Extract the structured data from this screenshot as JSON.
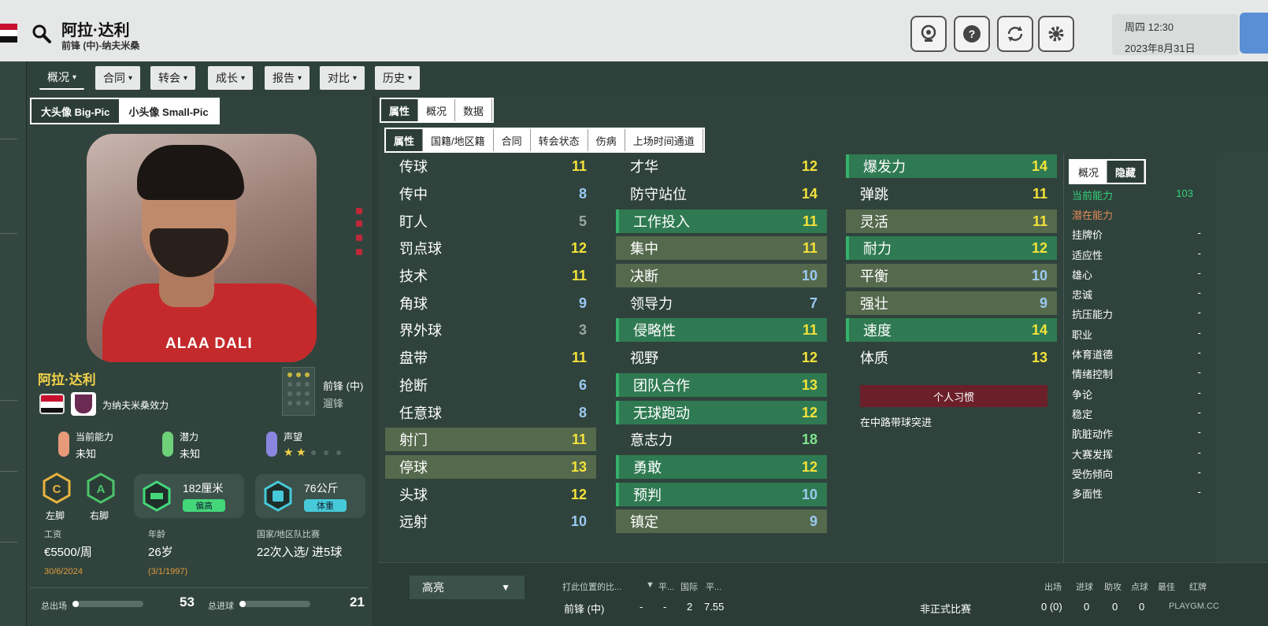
{
  "header": {
    "player_name": "阿拉·达利",
    "subtitle": "前锋 (中)-纳夫米桑",
    "date_line1": "周四 12:30",
    "date_line2": "2023年8月31日"
  },
  "main_tabs": [
    {
      "label": "概况"
    },
    {
      "label": "合同"
    },
    {
      "label": "转会"
    },
    {
      "label": "成长"
    },
    {
      "label": "报告"
    },
    {
      "label": "对比"
    },
    {
      "label": "历史"
    }
  ],
  "pic_toggle": {
    "big": "大头像 Big-Pic",
    "small": "小头像 Small-Pic"
  },
  "portrait": {
    "caption": "ALAA DALI"
  },
  "profile": {
    "name": "阿拉·达利",
    "club_text": "为纳夫米桑效力",
    "position_main": "前锋 (中)",
    "position_sub": "遛锋",
    "current_ability_label": "当前能力",
    "current_ability_value": "未知",
    "potential_label": "潜力",
    "potential_value": "未知",
    "reputation_label": "声望",
    "left_foot": "左脚",
    "right_foot": "右脚",
    "height": "182厘米",
    "height_tag": "偏高",
    "weight": "76公斤",
    "weight_tag": "体重",
    "wage_label": "工资",
    "wage_value": "€5500/周",
    "wage_date": "30/6/2024",
    "age_label": "年龄",
    "age_value": "26岁",
    "age_date": "(3/1/1997)",
    "intl_label": "国家/地区队比赛",
    "intl_value": "22次入选/ 进5球",
    "apps_label": "总出场",
    "apps_value": "53",
    "goals_label": "总进球",
    "goals_value": "21"
  },
  "right_tabs": [
    {
      "label": "属性"
    },
    {
      "label": "概况"
    },
    {
      "label": "数据"
    }
  ],
  "sub_tabs": [
    {
      "label": "属性"
    },
    {
      "label": "国籍/地区籍"
    },
    {
      "label": "合同"
    },
    {
      "label": "转会状态"
    },
    {
      "label": "伤病"
    },
    {
      "label": "上场时间通道"
    }
  ],
  "technical": [
    {
      "name": "传球",
      "value": "11"
    },
    {
      "name": "传中",
      "value": "8"
    },
    {
      "name": "盯人",
      "value": "5"
    },
    {
      "name": "罚点球",
      "value": "12"
    },
    {
      "name": "技术",
      "value": "11"
    },
    {
      "name": "角球",
      "value": "9"
    },
    {
      "name": "界外球",
      "value": "3"
    },
    {
      "name": "盘带",
      "value": "11"
    },
    {
      "name": "抢断",
      "value": "6"
    },
    {
      "name": "任意球",
      "value": "8"
    },
    {
      "name": "射门",
      "value": "11"
    },
    {
      "name": "停球",
      "value": "13"
    },
    {
      "name": "头球",
      "value": "12"
    },
    {
      "name": "远射",
      "value": "10"
    }
  ],
  "mental": [
    {
      "name": "才华",
      "value": "12"
    },
    {
      "name": "防守站位",
      "value": "14"
    },
    {
      "name": "工作投入",
      "value": "11"
    },
    {
      "name": "集中",
      "value": "11"
    },
    {
      "name": "决断",
      "value": "10"
    },
    {
      "name": "领导力",
      "value": "7"
    },
    {
      "name": "侵略性",
      "value": "11"
    },
    {
      "name": "视野",
      "value": "12"
    },
    {
      "name": "团队合作",
      "value": "13"
    },
    {
      "name": "无球跑动",
      "value": "12"
    },
    {
      "name": "意志力",
      "value": "18"
    },
    {
      "name": "勇敢",
      "value": "12"
    },
    {
      "name": "预判",
      "value": "10"
    },
    {
      "name": "镇定",
      "value": "9"
    }
  ],
  "physical": [
    {
      "name": "爆发力",
      "value": "14"
    },
    {
      "name": "弹跳",
      "value": "11"
    },
    {
      "name": "灵活",
      "value": "11"
    },
    {
      "name": "耐力",
      "value": "12"
    },
    {
      "name": "平衡",
      "value": "10"
    },
    {
      "name": "强壮",
      "value": "9"
    },
    {
      "name": "速度",
      "value": "14"
    },
    {
      "name": "体质",
      "value": "13"
    }
  ],
  "habits": {
    "button": "个人习惯",
    "text": "在中路带球突进"
  },
  "hidden_tabs": [
    {
      "label": "概况"
    },
    {
      "label": "隐藏"
    }
  ],
  "hidden": [
    {
      "name": "当前能力",
      "value": "103"
    },
    {
      "name": "潜在能力",
      "value": ""
    },
    {
      "name": "挂牌价",
      "value": "-"
    },
    {
      "name": "适应性",
      "value": "-"
    },
    {
      "name": "雄心",
      "value": "-"
    },
    {
      "name": "忠诚",
      "value": "-"
    },
    {
      "name": "抗压能力",
      "value": "-"
    },
    {
      "name": "职业",
      "value": "-"
    },
    {
      "name": "体育道德",
      "value": "-"
    },
    {
      "name": "情绪控制",
      "value": "-"
    },
    {
      "name": "争论",
      "value": "-"
    },
    {
      "name": "稳定",
      "value": "-"
    },
    {
      "name": "肮脏动作",
      "value": "-"
    },
    {
      "name": "大赛发挥",
      "value": "-"
    },
    {
      "name": "受伤倾向",
      "value": "-"
    },
    {
      "name": "多面性",
      "value": "-"
    }
  ],
  "bottom": {
    "highlight": "高亮",
    "col1": "打此位置的比...",
    "col2": "平...",
    "col3": "国际",
    "col4": "平...",
    "row_pos": "前锋 (中)",
    "row_a": "-",
    "row_b": "-",
    "row_c": "2",
    "row_d": "7.55",
    "stat_headers": [
      "出场",
      "进球",
      "助攻",
      "点球",
      "最佳",
      "红牌"
    ],
    "friendly_label": "非正式比赛",
    "friendly_values": [
      "0 (0)",
      "0",
      "0",
      "0"
    ],
    "watermark": "PLAYGM.CC"
  }
}
